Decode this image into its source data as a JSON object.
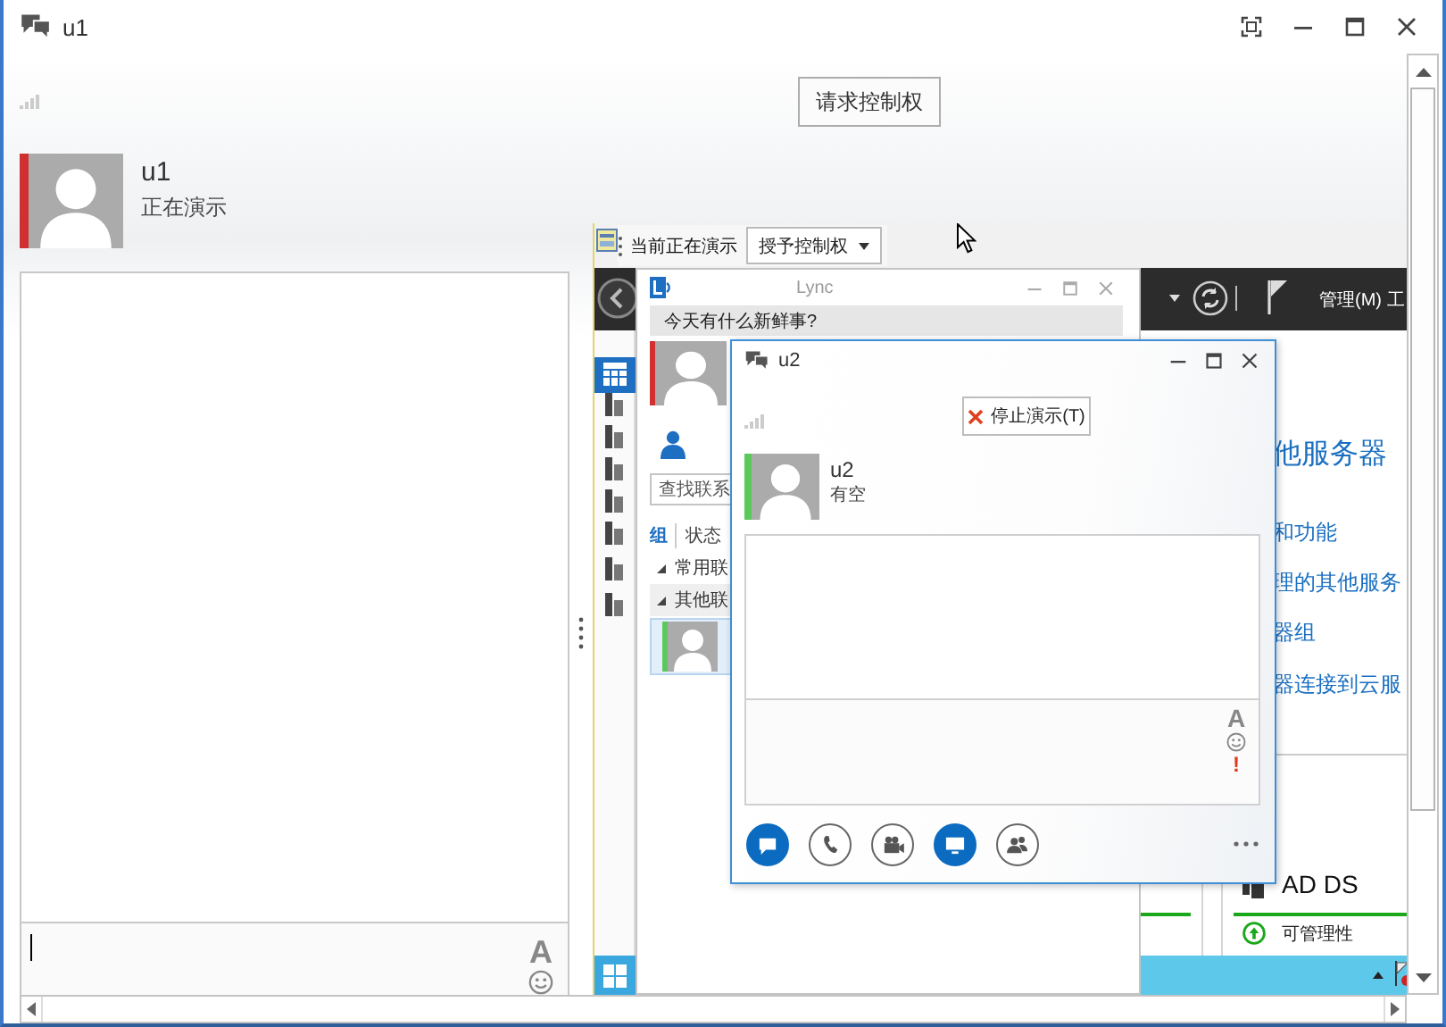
{
  "window": {
    "title": "u1"
  },
  "request_control_button": "请求控制权",
  "contact": {
    "name": "u1",
    "status": "正在演示",
    "color": "#d0302f"
  },
  "message_input": {
    "font_button": "A"
  },
  "shared_desktop": {
    "presenter_bar": {
      "label": "当前正在演示",
      "button": "授予控制权"
    },
    "server_manager": {
      "menu_items": [
        "管理(M)",
        "工"
      ],
      "heading": "他服务器",
      "links": [
        "和功能",
        "理的其他服务",
        "器组",
        "器连接到云服"
      ],
      "tile": {
        "title": "AD DS",
        "status": "可管理性"
      }
    },
    "lync": {
      "title": "Lync",
      "prompt": "今天有什么新鲜事?",
      "self": {
        "color": "#d0302f"
      },
      "search_placeholder": "查找联系",
      "tabs": [
        {
          "label": "组",
          "selected": true
        },
        {
          "label": "状态",
          "selected": false
        }
      ],
      "groups": [
        "常用联",
        "其他联"
      ],
      "contacts": [
        {
          "color": "#5ac85a"
        }
      ]
    },
    "conversation": {
      "title": "u2",
      "stop_button": "停止演示(T)",
      "contact": {
        "name": "u2",
        "status": "有空",
        "color": "#5ac85a"
      },
      "input_tools": {
        "font_button": "A",
        "importance": "!"
      },
      "actions": [
        {
          "kind": "chat",
          "selected": true
        },
        {
          "kind": "call",
          "selected": false
        },
        {
          "kind": "video",
          "selected": false
        },
        {
          "kind": "present",
          "selected": true
        },
        {
          "kind": "people",
          "selected": false
        }
      ]
    }
  }
}
